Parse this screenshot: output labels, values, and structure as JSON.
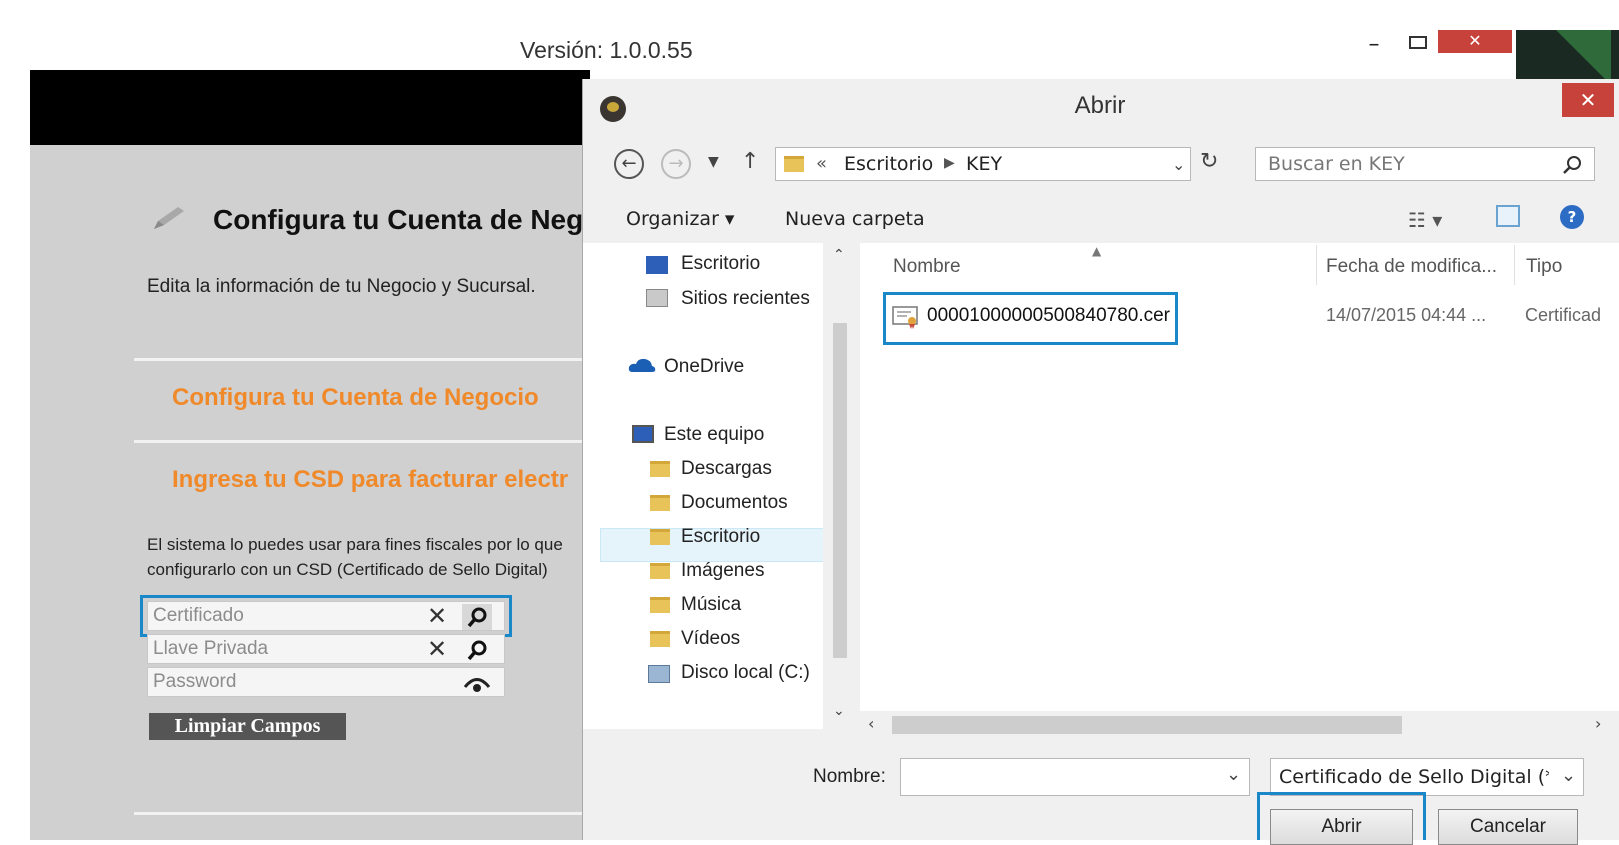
{
  "app": {
    "version": "Versión: 1.0.0.55",
    "minimize": "–",
    "close": "✕"
  },
  "config": {
    "title": "Configura tu Cuenta de Neg",
    "subtitle": "Edita la información de tu Negocio y Sucursal.",
    "section1": "Configura tu Cuenta de Negocio",
    "section2": "Ingresa tu CSD para facturar electr",
    "desc_line1": "El sistema lo puedes usar para fines fiscales por lo que",
    "desc_line2": "configurarlo con un CSD (Certificado de Sello Digital)",
    "fields": {
      "certificado": "Certificado",
      "llave": "Llave Privada",
      "password": "Password"
    },
    "clear_button": "Limpiar Campos"
  },
  "dialog": {
    "title": "Abrir",
    "close": "✕",
    "breadcrumb": [
      "«",
      "Escritorio",
      "KEY"
    ],
    "search_placeholder": "Buscar en KEY",
    "organize": "Organizar ▾",
    "new_folder": "Nueva carpeta",
    "nav_items": [
      "Escritorio",
      "Sitios recientes",
      "OneDrive",
      "Este equipo",
      "Descargas",
      "Documentos",
      "Escritorio",
      "Imágenes",
      "Música",
      "Vídeos",
      "Disco local (C:)"
    ],
    "columns": {
      "name": "Nombre",
      "date": "Fecha de modifica...",
      "type": "Tipo"
    },
    "file": {
      "name": "00001000000500840780.cer",
      "date": "14/07/2015 04:44 ...",
      "type": "Certificad"
    },
    "filename_label": "Nombre:",
    "filename_value": "",
    "filter": "Certificado de Sello Digital (*.ce",
    "open_button": "Abrir",
    "cancel_button": "Cancelar"
  },
  "colors": {
    "accent_orange": "#f0892a",
    "highlight_blue": "#1a87c9",
    "close_red": "#c7423a"
  }
}
